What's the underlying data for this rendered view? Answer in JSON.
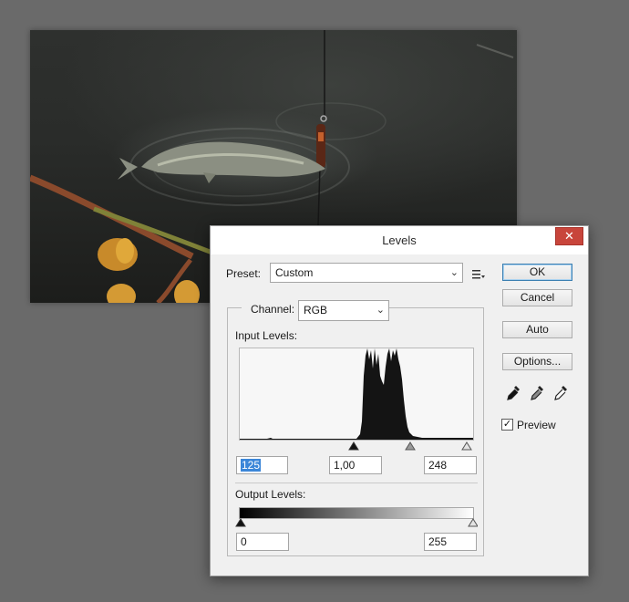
{
  "dialog": {
    "title": "Levels",
    "close_glyph": "✕",
    "preset_label": "Preset:",
    "preset_value": "Custom",
    "channel_label": "Channel:",
    "channel_value": "RGB",
    "input_levels_label": "Input Levels:",
    "input_black": "125",
    "input_gamma": "1,00",
    "input_white": "248",
    "output_levels_label": "Output Levels:",
    "output_black": "0",
    "output_white": "255",
    "buttons": {
      "ok": "OK",
      "cancel": "Cancel",
      "auto": "Auto",
      "options": "Options..."
    },
    "preview_label": "Preview",
    "preview_checked": true,
    "check_glyph": "✓",
    "dropdown_glyph": "⌄",
    "icons": [
      "close-icon",
      "preset-menu-icon",
      "black-eyedropper-icon",
      "gray-eyedropper-icon",
      "white-eyedropper-icon",
      "chevron-down-icon"
    ]
  },
  "colors": {
    "window_bg": "#f0f0f0",
    "close_button": "#c8453b",
    "selection": "#3b86d8",
    "workspace": "#6a6a6a"
  }
}
